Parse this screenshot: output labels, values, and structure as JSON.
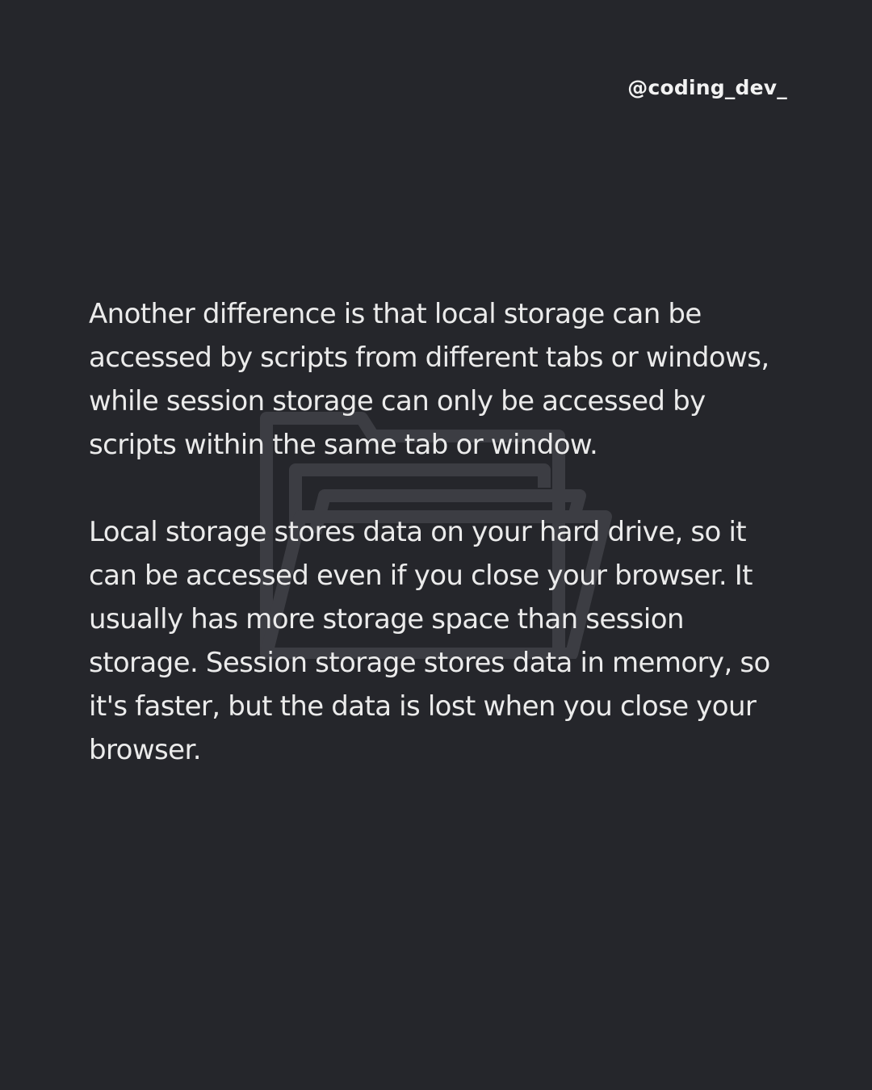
{
  "post": {
    "handle": "@coding_dev_",
    "paragraphs": [
      "Another difference is that local storage can be accessed by scripts from different tabs or windows, while session storage can only be accessed by scripts within the same tab or window.",
      "Local storage stores data on your hard drive, so it can be accessed even if you close your browser. It usually has more storage space than session storage. Session storage stores data in memory, so it's faster, but the data is lost when you close your browser."
    ],
    "background_icon": "folder-icon"
  },
  "colors": {
    "background": "#25262b",
    "text": "#ebebeb",
    "icon_outline": "#3c3d43"
  }
}
